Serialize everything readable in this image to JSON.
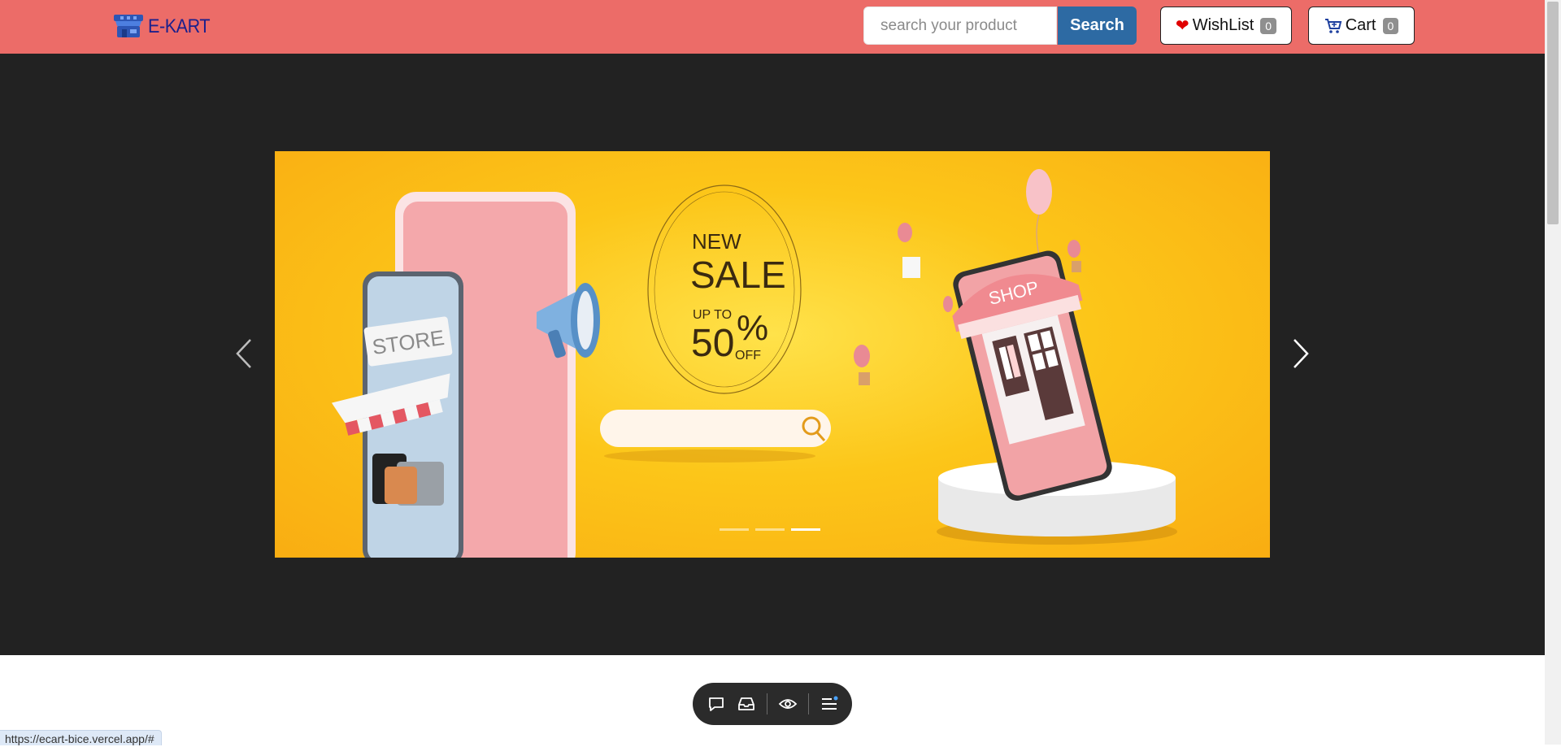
{
  "brand": {
    "name": "E-KART",
    "icon": "store-icon"
  },
  "search": {
    "placeholder": "search your product",
    "value": "",
    "button_label": "Search"
  },
  "wishlist": {
    "label": "WishList",
    "count": "0",
    "icon": "heart-icon"
  },
  "cart": {
    "label": "Cart",
    "count": "0",
    "icon": "cart-icon"
  },
  "carousel": {
    "active_slide": 3,
    "slide_count": 3,
    "banner": {
      "store_sign": "STORE",
      "sale_new": "NEW",
      "sale_word": "SALE",
      "sale_upto": "UP TO",
      "sale_percent": "50",
      "sale_percent_sign": "%",
      "sale_off": "OFF",
      "shop_sign": "SHOP"
    }
  },
  "toolbar": {
    "items": [
      "chat-icon",
      "inbox-icon",
      "eye-icon",
      "menu-icon"
    ]
  },
  "status_url": "https://ecart-bice.vercel.app/#",
  "colors": {
    "navbar": "#ec6c68",
    "search_button": "#2d6aa3",
    "brand_text": "#1b1f8c",
    "hero_background": "#222222",
    "banner_yellow": "#fcc619"
  }
}
